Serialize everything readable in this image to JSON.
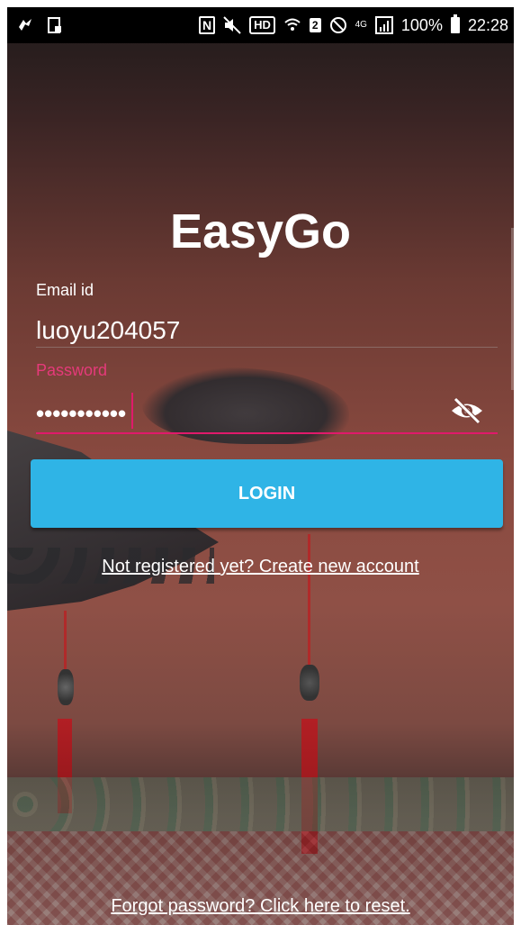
{
  "status_bar": {
    "left_icons": [
      "app-notification-icon",
      "screenshot-icon"
    ],
    "nfc": "N",
    "hd": "HD",
    "sim": "2",
    "network": "4G",
    "battery": "100%",
    "time": "22:28"
  },
  "app": {
    "title": "EasyGo"
  },
  "form": {
    "email_label": "Email id",
    "email_value": "luoyu204057",
    "password_label": "Password",
    "password_masked": "•••••••••••",
    "login_button": "LOGIN"
  },
  "links": {
    "register": "Not registered yet? Create new account",
    "forgot": "Forgot password? Click here to reset."
  },
  "colors": {
    "accent_pink": "#e01a6b",
    "button_blue": "#2fb4e6"
  }
}
